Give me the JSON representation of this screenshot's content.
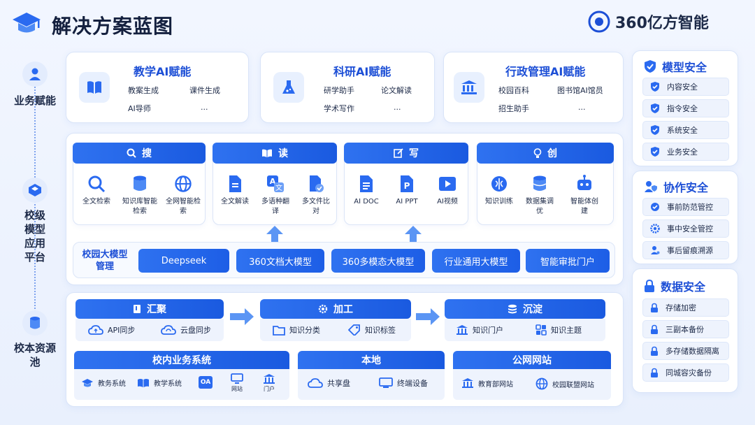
{
  "header": {
    "title": "解决方案蓝图",
    "brand": "360亿方智能",
    "brand_badge": "AI"
  },
  "side_labels": {
    "business": "业务赋能",
    "platform": "校级模型应用平台",
    "resources": "校本资源池"
  },
  "business": [
    {
      "title": "教学AI赋能",
      "items": [
        "教案生成",
        "课件生成",
        "AI导师",
        "..."
      ]
    },
    {
      "title": "科研AI赋能",
      "items": [
        "研学助手",
        "论文解读",
        "学术写作",
        "..."
      ]
    },
    {
      "title": "行政管理AI赋能",
      "items": [
        "校园百科",
        "图书馆AI馆员",
        "招生助手",
        "..."
      ]
    }
  ],
  "platform": {
    "categories": [
      {
        "label": "搜",
        "items": [
          "全文检索",
          "知识库智能检索",
          "全网智能检索"
        ]
      },
      {
        "label": "读",
        "items": [
          "全文解读",
          "多语种翻译",
          "多文件比对"
        ]
      },
      {
        "label": "写",
        "items": [
          "AI DOC",
          "AI PPT",
          "AI视频"
        ]
      },
      {
        "label": "创",
        "items": [
          "知识训练",
          "数据集调优",
          "智能体创建"
        ]
      }
    ],
    "models_label": "校园大模型管理",
    "models": [
      "Deepseek",
      "360文档大模型",
      "360多模态大模型",
      "行业通用大模型",
      "智能审批门户"
    ]
  },
  "pipeline": [
    {
      "label": "汇聚",
      "items": [
        "API同步",
        "云盘同步"
      ]
    },
    {
      "label": "加工",
      "items": [
        "知识分类",
        "知识标签"
      ]
    },
    {
      "label": "沉淀",
      "items": [
        "知识门户",
        "知识主题"
      ]
    }
  ],
  "sources": [
    {
      "label": "校内业务系统",
      "items": [
        "教务系统",
        "教学系统",
        "OA",
        "网站",
        "门户"
      ]
    },
    {
      "label": "本地",
      "items": [
        "共享盘",
        "终端设备"
      ]
    },
    {
      "label": "公网网站",
      "items": [
        "教育部网站",
        "校园联盟网站"
      ]
    }
  ],
  "security": [
    {
      "title": "模型安全",
      "items": [
        "内容安全",
        "指令安全",
        "系统安全",
        "业务安全"
      ]
    },
    {
      "title": "协作安全",
      "items": [
        "事前防范管控",
        "事中安全管控",
        "事后留痕溯源"
      ]
    },
    {
      "title": "数据安全",
      "items": [
        "存储加密",
        "三副本备份",
        "多存储数据隔离",
        "同城容灾备份"
      ]
    }
  ],
  "colors": {
    "primary": "#1d5ee6",
    "accent": "#2f72f0",
    "text": "#1d2a48",
    "panel": "#ffffff"
  }
}
